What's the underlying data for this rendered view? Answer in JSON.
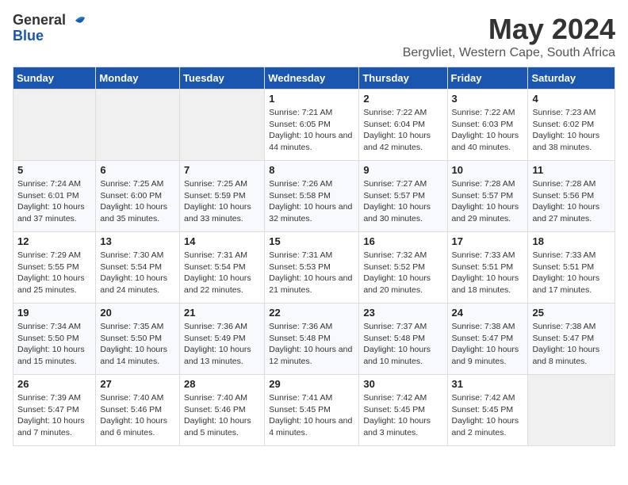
{
  "header": {
    "logo_general": "General",
    "logo_blue": "Blue",
    "title": "May 2024",
    "subtitle": "Bergvliet, Western Cape, South Africa"
  },
  "weekdays": [
    "Sunday",
    "Monday",
    "Tuesday",
    "Wednesday",
    "Thursday",
    "Friday",
    "Saturday"
  ],
  "weeks": [
    [
      {
        "day": "",
        "empty": true
      },
      {
        "day": "",
        "empty": true
      },
      {
        "day": "",
        "empty": true
      },
      {
        "day": "1",
        "sunrise": "7:21 AM",
        "sunset": "6:05 PM",
        "daylight": "10 hours and 44 minutes."
      },
      {
        "day": "2",
        "sunrise": "7:22 AM",
        "sunset": "6:04 PM",
        "daylight": "10 hours and 42 minutes."
      },
      {
        "day": "3",
        "sunrise": "7:22 AM",
        "sunset": "6:03 PM",
        "daylight": "10 hours and 40 minutes."
      },
      {
        "day": "4",
        "sunrise": "7:23 AM",
        "sunset": "6:02 PM",
        "daylight": "10 hours and 38 minutes."
      }
    ],
    [
      {
        "day": "5",
        "sunrise": "7:24 AM",
        "sunset": "6:01 PM",
        "daylight": "10 hours and 37 minutes."
      },
      {
        "day": "6",
        "sunrise": "7:25 AM",
        "sunset": "6:00 PM",
        "daylight": "10 hours and 35 minutes."
      },
      {
        "day": "7",
        "sunrise": "7:25 AM",
        "sunset": "5:59 PM",
        "daylight": "10 hours and 33 minutes."
      },
      {
        "day": "8",
        "sunrise": "7:26 AM",
        "sunset": "5:58 PM",
        "daylight": "10 hours and 32 minutes."
      },
      {
        "day": "9",
        "sunrise": "7:27 AM",
        "sunset": "5:57 PM",
        "daylight": "10 hours and 30 minutes."
      },
      {
        "day": "10",
        "sunrise": "7:28 AM",
        "sunset": "5:57 PM",
        "daylight": "10 hours and 29 minutes."
      },
      {
        "day": "11",
        "sunrise": "7:28 AM",
        "sunset": "5:56 PM",
        "daylight": "10 hours and 27 minutes."
      }
    ],
    [
      {
        "day": "12",
        "sunrise": "7:29 AM",
        "sunset": "5:55 PM",
        "daylight": "10 hours and 25 minutes."
      },
      {
        "day": "13",
        "sunrise": "7:30 AM",
        "sunset": "5:54 PM",
        "daylight": "10 hours and 24 minutes."
      },
      {
        "day": "14",
        "sunrise": "7:31 AM",
        "sunset": "5:54 PM",
        "daylight": "10 hours and 22 minutes."
      },
      {
        "day": "15",
        "sunrise": "7:31 AM",
        "sunset": "5:53 PM",
        "daylight": "10 hours and 21 minutes."
      },
      {
        "day": "16",
        "sunrise": "7:32 AM",
        "sunset": "5:52 PM",
        "daylight": "10 hours and 20 minutes."
      },
      {
        "day": "17",
        "sunrise": "7:33 AM",
        "sunset": "5:51 PM",
        "daylight": "10 hours and 18 minutes."
      },
      {
        "day": "18",
        "sunrise": "7:33 AM",
        "sunset": "5:51 PM",
        "daylight": "10 hours and 17 minutes."
      }
    ],
    [
      {
        "day": "19",
        "sunrise": "7:34 AM",
        "sunset": "5:50 PM",
        "daylight": "10 hours and 15 minutes."
      },
      {
        "day": "20",
        "sunrise": "7:35 AM",
        "sunset": "5:50 PM",
        "daylight": "10 hours and 14 minutes."
      },
      {
        "day": "21",
        "sunrise": "7:36 AM",
        "sunset": "5:49 PM",
        "daylight": "10 hours and 13 minutes."
      },
      {
        "day": "22",
        "sunrise": "7:36 AM",
        "sunset": "5:48 PM",
        "daylight": "10 hours and 12 minutes."
      },
      {
        "day": "23",
        "sunrise": "7:37 AM",
        "sunset": "5:48 PM",
        "daylight": "10 hours and 10 minutes."
      },
      {
        "day": "24",
        "sunrise": "7:38 AM",
        "sunset": "5:47 PM",
        "daylight": "10 hours and 9 minutes."
      },
      {
        "day": "25",
        "sunrise": "7:38 AM",
        "sunset": "5:47 PM",
        "daylight": "10 hours and 8 minutes."
      }
    ],
    [
      {
        "day": "26",
        "sunrise": "7:39 AM",
        "sunset": "5:47 PM",
        "daylight": "10 hours and 7 minutes."
      },
      {
        "day": "27",
        "sunrise": "7:40 AM",
        "sunset": "5:46 PM",
        "daylight": "10 hours and 6 minutes."
      },
      {
        "day": "28",
        "sunrise": "7:40 AM",
        "sunset": "5:46 PM",
        "daylight": "10 hours and 5 minutes."
      },
      {
        "day": "29",
        "sunrise": "7:41 AM",
        "sunset": "5:45 PM",
        "daylight": "10 hours and 4 minutes."
      },
      {
        "day": "30",
        "sunrise": "7:42 AM",
        "sunset": "5:45 PM",
        "daylight": "10 hours and 3 minutes."
      },
      {
        "day": "31",
        "sunrise": "7:42 AM",
        "sunset": "5:45 PM",
        "daylight": "10 hours and 2 minutes."
      },
      {
        "day": "",
        "empty": true
      }
    ]
  ],
  "labels": {
    "sunrise": "Sunrise:",
    "sunset": "Sunset:",
    "daylight": "Daylight:"
  }
}
